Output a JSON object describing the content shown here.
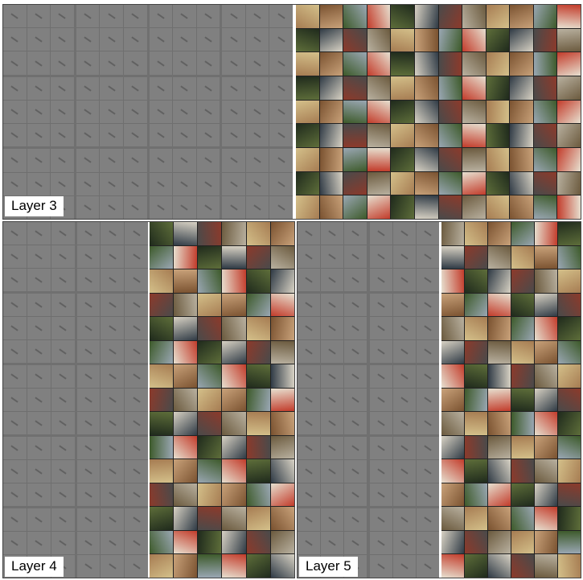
{
  "labels": {
    "layer3": "Layer 3",
    "layer4": "Layer 4",
    "layer5": "Layer 5"
  },
  "colors": {
    "feature_bg": "#808080",
    "block_gap": "#6f6f6f",
    "page_bg": "#ffffff"
  },
  "photo_palette": [
    "#6b5a3e",
    "#b9b1a0",
    "#3d5a2a",
    "#8c3a2b",
    "#d8d2c4",
    "#2f3a45",
    "#a67c52",
    "#5e6e3a",
    "#c23b2a",
    "#e7e0d0",
    "#4a4a4a",
    "#9aa7b3",
    "#7a5230",
    "#c9a27a",
    "#1f2a1c",
    "#d4c08a"
  ]
}
